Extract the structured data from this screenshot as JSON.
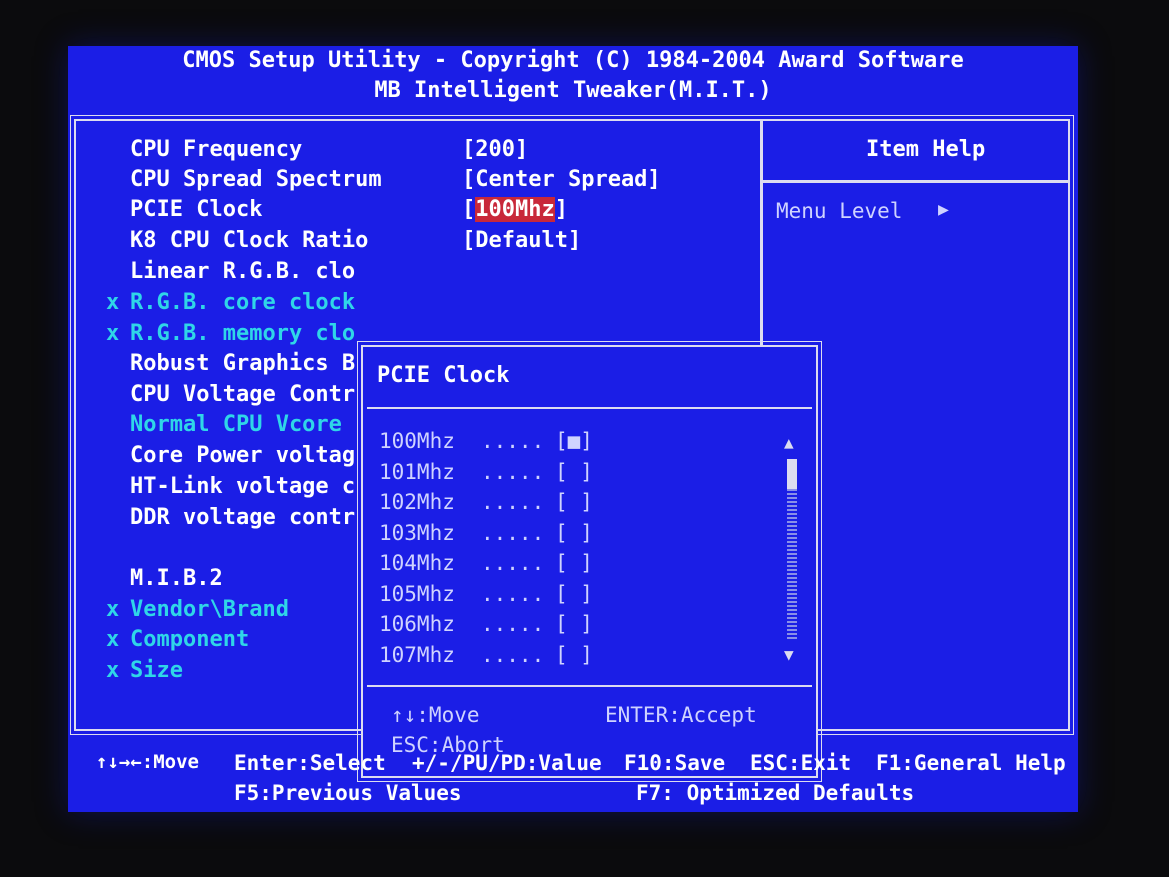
{
  "header": {
    "line1": "CMOS Setup Utility - Copyright (C) 1984-2004 Award Software",
    "line2": "MB Intelligent Tweaker(M.I.T.)"
  },
  "menu_items": [
    {
      "prefix": "",
      "label": "CPU Frequency",
      "value": "[200]",
      "color": "#ffffff"
    },
    {
      "prefix": "",
      "label": "CPU Spread Spectrum",
      "value": "[Center Spread]",
      "color": "#ffffff"
    },
    {
      "prefix": "",
      "label": "PCIE Clock",
      "value_open": "[",
      "value_sel": "100Mhz",
      "value_close": "]",
      "color": "#ffffff"
    },
    {
      "prefix": "",
      "label": "K8 CPU Clock Ratio",
      "value": "[Default]",
      "color": "#ffffff"
    },
    {
      "prefix": "",
      "label": "Linear R.G.B. clo",
      "value": "",
      "color": "#ffffff"
    },
    {
      "prefix": "x",
      "label": "R.G.B. core clock",
      "value": "",
      "color": "#2fd6e8"
    },
    {
      "prefix": "x",
      "label": "R.G.B. memory clo",
      "value": "",
      "color": "#2fd6e8"
    },
    {
      "prefix": "",
      "label": "Robust Graphics B",
      "value": "",
      "color": "#ffffff"
    },
    {
      "prefix": "",
      "label": "CPU Voltage Contr",
      "value": "",
      "color": "#ffffff"
    },
    {
      "prefix": "",
      "label": "Normal CPU Vcore",
      "value": "",
      "color": "#2fd6e8"
    },
    {
      "prefix": "",
      "label": "Core Power voltag",
      "value": "",
      "color": "#ffffff"
    },
    {
      "prefix": "",
      "label": "HT-Link voltage c",
      "value": "",
      "color": "#ffffff"
    },
    {
      "prefix": "",
      "label": "DDR voltage contr",
      "value": "",
      "color": "#ffffff"
    },
    {
      "prefix": "",
      "label": "M.I.B.2",
      "value": "",
      "color": "#ffffff"
    },
    {
      "prefix": "x",
      "label": "Vendor\\Brand",
      "value": "",
      "color": "#2fd6e8"
    },
    {
      "prefix": "x",
      "label": "Component",
      "value": "",
      "color": "#2fd6e8"
    },
    {
      "prefix": "x",
      "label": "Size",
      "value": "",
      "color": "#2fd6e8"
    }
  ],
  "help_panel": {
    "title": "Item Help",
    "menu_level": "Menu Level",
    "menu_level_arrow": "▶"
  },
  "popup": {
    "title": "PCIE Clock",
    "options": [
      {
        "label": "100Mhz",
        "dots": ".....",
        "mark": "[■]"
      },
      {
        "label": "101Mhz",
        "dots": ".....",
        "mark": "[ ]"
      },
      {
        "label": "102Mhz",
        "dots": ".....",
        "mark": "[ ]"
      },
      {
        "label": "103Mhz",
        "dots": ".....",
        "mark": "[ ]"
      },
      {
        "label": "104Mhz",
        "dots": ".....",
        "mark": "[ ]"
      },
      {
        "label": "105Mhz",
        "dots": ".....",
        "mark": "[ ]"
      },
      {
        "label": "106Mhz",
        "dots": ".....",
        "mark": "[ ]"
      },
      {
        "label": "107Mhz",
        "dots": ".....",
        "mark": "[ ]"
      }
    ],
    "scroll_up": "▲",
    "scroll_down": "▼",
    "key_move": "↑↓:Move",
    "key_accept": "ENTER:Accept",
    "key_abort": "ESC:Abort"
  },
  "footer": {
    "move": "↑↓→←:Move",
    "select": "Enter:Select",
    "value": "+/-/PU/PD:Value",
    "save": "F10:Save",
    "exit": "ESC:Exit",
    "help": "F1:General Help",
    "prev": "F5:Previous Values",
    "optimized": "F7: Optimized Defaults"
  },
  "colors": {
    "background": "#1b1ee6",
    "text": "#ffffff",
    "disabled": "#2fd6e8",
    "highlight": "#c8283a"
  }
}
